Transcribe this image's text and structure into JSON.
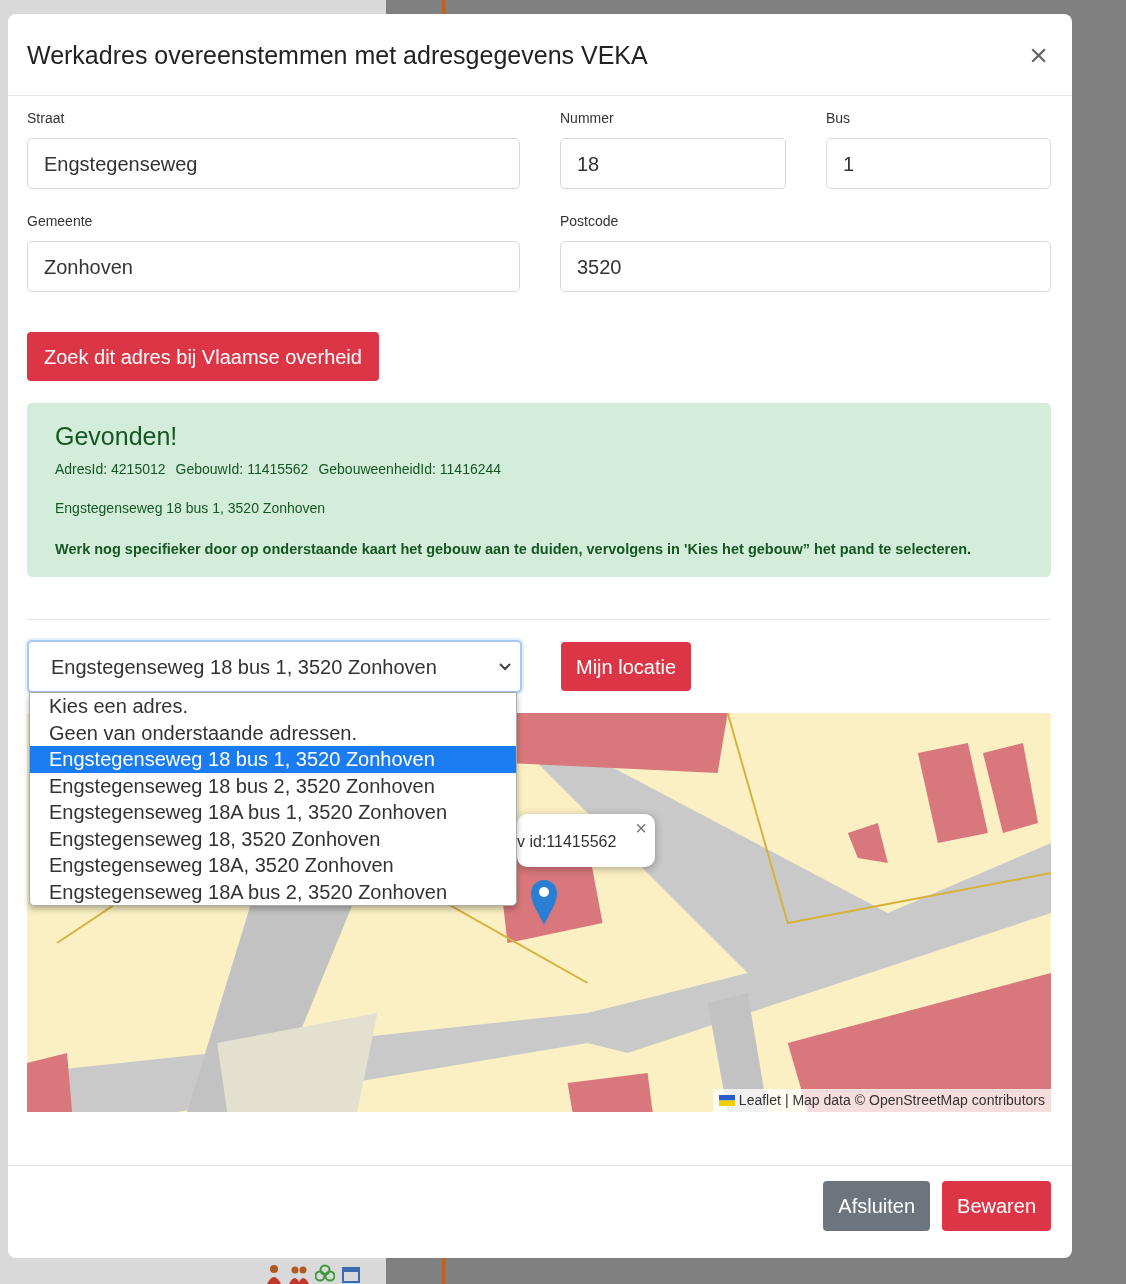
{
  "dialog": {
    "title": "Werkadres overeenstemmen met adresgegevens VEKA",
    "close": "×"
  },
  "field_rows": [
    [
      {
        "label": "Straat",
        "value": "Engstegenseweg"
      },
      {
        "label": "Nummer",
        "value": "18"
      },
      {
        "label": "Bus",
        "value": "1"
      }
    ],
    [
      {
        "label": "Gemeente",
        "value": "Zonhoven"
      },
      {
        "label": "Postcode",
        "value": "3520"
      }
    ]
  ],
  "search_button": "Zoek dit adres bij Vlaamse overheid",
  "result": {
    "heading": "Gevonden!",
    "ids": [
      "AdresId: 4215012",
      "GebouwId: 11415562",
      "GebouweenheidId: 11416244"
    ],
    "address": "Engstegenseweg 18 bus 1, 3520 Zonhoven",
    "instruction": "Werk nog specifieker door op onderstaande kaart het gebouw aan te duiden, vervolgens in 'Kies het gebouw” het pand te selecteren."
  },
  "address_select": {
    "value": "Engstegenseweg 18 bus 1, 3520 Zonhoven",
    "open": true,
    "options": [
      {
        "label": "Kies een adres.",
        "selected": false
      },
      {
        "label": "Geen van onderstaande adressen.",
        "selected": false
      },
      {
        "label": "Engstegenseweg 18 bus 1, 3520 Zonhoven",
        "selected": true
      },
      {
        "label": "Engstegenseweg 18 bus 2, 3520 Zonhoven",
        "selected": false
      },
      {
        "label": "Engstegenseweg 18A bus 1, 3520 Zonhoven",
        "selected": false
      },
      {
        "label": "Engstegenseweg 18, 3520 Zonhoven",
        "selected": false
      },
      {
        "label": "Engstegenseweg 18A, 3520 Zonhoven",
        "selected": false
      },
      {
        "label": "Engstegenseweg 18A bus 2, 3520 Zonhoven",
        "selected": false
      }
    ]
  },
  "location_button": "Mijn locatie",
  "map": {
    "popup": {
      "text": "v id:11415562",
      "close": "×"
    },
    "attribution": {
      "leaflet": "Leaflet",
      "middle": "| Map data ©",
      "osm": "OpenStreetMap",
      "suffix": "contributors"
    }
  },
  "footer_buttons": [
    {
      "label": "Afsluiten",
      "kind": "secondary"
    },
    {
      "label": "Bewaren",
      "kind": "danger"
    }
  ]
}
